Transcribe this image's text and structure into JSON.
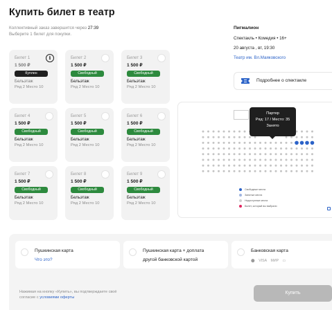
{
  "page": {
    "title": "Купить билет в театр"
  },
  "order": {
    "timer_text": "Коллективный заказ завершится через",
    "timer_value": "27:39",
    "instruction": "Выберите 1 билет для покупки."
  },
  "tickets": [
    {
      "name": "Билет 1",
      "price": "1 500 ₽",
      "status": "Куплен",
      "zone": "Бельэтаж",
      "seat": "Ряд 2  Место 10"
    },
    {
      "name": "Билет 2",
      "price": "1 500 ₽",
      "status": "Свободный",
      "zone": "Бельэтаж",
      "seat": "Ряд 2  Место 10"
    },
    {
      "name": "Билет 3",
      "price": "1 500 ₽",
      "status": "Свободный",
      "zone": "Бельэтаж",
      "seat": "Ряд 2  Место 10"
    },
    {
      "name": "Билет 4",
      "price": "1 500 ₽",
      "status": "Свободный",
      "zone": "Бельэтаж",
      "seat": "Ряд 2  Место 10"
    },
    {
      "name": "Билет 5",
      "price": "1 500 ₽",
      "status": "Свободный",
      "zone": "Бельэтаж",
      "seat": "Ряд 2  Место 10"
    },
    {
      "name": "Билет 6",
      "price": "1 500 ₽",
      "status": "Свободный",
      "zone": "Бельэтаж",
      "seat": "Ряд 2  Место 10"
    },
    {
      "name": "Билет 7",
      "price": "1 500 ₽",
      "status": "Свободный",
      "zone": "Бельэтаж",
      "seat": "Ряд 2  Место 10"
    },
    {
      "name": "Билет 8",
      "price": "1 500 ₽",
      "status": "Свободный",
      "zone": "Бельэтаж",
      "seat": "Ряд 2  Место 10"
    },
    {
      "name": "Билет 9",
      "price": "1 500 ₽",
      "status": "Свободный",
      "zone": "Бельэтаж",
      "seat": "Ряд 2  Место 10"
    }
  ],
  "show": {
    "name": "Пигмалион",
    "genre": "Спектакль • Комедия • 16+",
    "date": "20 августа , вт, 19:30",
    "theatre": "Театр им. Вл.Маяковского",
    "more_label": "Подробнее о спектакле",
    "more_icon": "ticket-icon"
  },
  "hall": {
    "tooltip": {
      "zone": "Партер",
      "seat": "Ряд: 17 / Место: 35",
      "status": "Занято"
    },
    "legend": [
      {
        "label": "Свободные места",
        "color": "#2c63c8"
      },
      {
        "label": "Занятые места",
        "color": "#9fb5e0"
      },
      {
        "label": "Недоступные места",
        "color": "#d0d0d0"
      },
      {
        "label": "Билет, который вы выбрали",
        "color": "#e0245e"
      }
    ]
  },
  "payment": {
    "option1": {
      "title": "Пушкинская карта",
      "link": "Что это?"
    },
    "option2": {
      "title": "Пушкинская карта + доплата",
      "subtitle": "другой банковской картой"
    },
    "option3": {
      "title": "Банковская карта",
      "logos": [
        "VISA",
        "МИР"
      ]
    },
    "note_text": "Нажимая на кнопку «Купить», вы подтверждаете своё",
    "note_text2": "согласие с",
    "note_link": "условиями оферты",
    "buy_label": "Купить"
  },
  "colors": {
    "free": "#2d8a3e",
    "bought": "#1f1f1f",
    "link": "#2c63c8",
    "seat_selected": "#2c63c8"
  }
}
